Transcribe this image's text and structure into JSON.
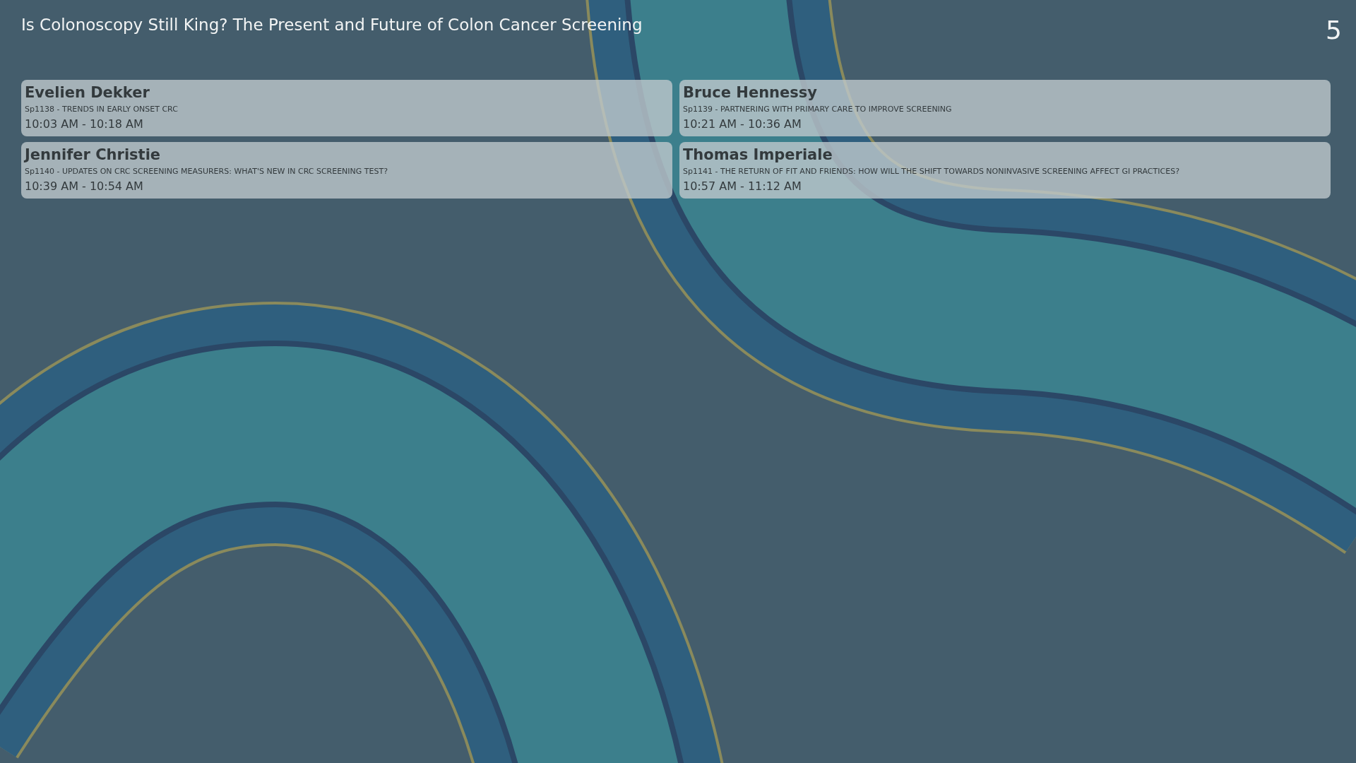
{
  "title": "Is Colonoscopy Still King? The Present and Future of Colon Cancer Screening",
  "page_number": "5",
  "sessions": [
    {
      "speaker": "Evelien Dekker",
      "talk": "Sp1138 - TRENDS IN EARLY ONSET CRC",
      "time": "10:03 AM - 10:18 AM"
    },
    {
      "speaker": "Bruce Hennessy",
      "talk": "Sp1139 - PARTNERING WITH PRIMARY CARE TO IMPROVE SCREENING",
      "time": "10:21 AM - 10:36 AM"
    },
    {
      "speaker": "Jennifer Christie",
      "talk": "Sp1140 - UPDATES ON CRC SCREENING MEASURERS: WHAT'S NEW IN CRC SCREENING TEST?",
      "time": "10:39 AM - 10:54 AM"
    },
    {
      "speaker": "Thomas Imperiale",
      "talk": "Sp1141 - THE RETURN OF FIT AND FRIENDS: HOW WILL THE SHIFT TOWARDS NONINVASIVE SCREENING AFFECT GI PRACTICES?",
      "time": "10:57 AM - 11:12 AM"
    }
  ]
}
